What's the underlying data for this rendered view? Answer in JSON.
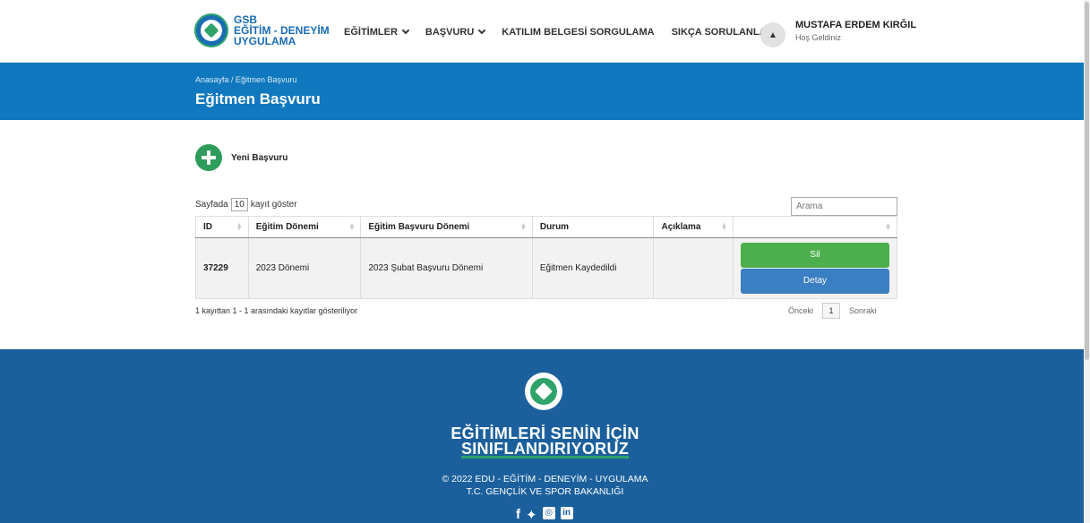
{
  "header": {
    "logo": {
      "line1": "GSB",
      "line2": "EĞİTİM - DENEYİM",
      "line3": "UYGULAMA"
    },
    "nav": [
      {
        "label": "EĞİTİMLER",
        "dropdown": true
      },
      {
        "label": "BAŞVURU",
        "dropdown": true
      },
      {
        "label": "KATILIM BELGESİ SORGULAMA",
        "dropdown": false
      },
      {
        "label": "SIKÇA SORULANLAR",
        "dropdown": false
      }
    ],
    "user": {
      "name": "MUSTAFA ERDEM KIRĞIL",
      "greeting": "Hoş Geldiniz"
    }
  },
  "banner": {
    "breadcrumb": "Anasayfa  /  Eğitmen Başvuru",
    "title": "Eğitmen Başvuru"
  },
  "actions": {
    "new_application": "Yeni Başvuru"
  },
  "table_controls": {
    "length_prefix": "Sayfada",
    "length_value": "10",
    "length_suffix": "kayıt göster",
    "search_placeholder": "Arama"
  },
  "table": {
    "columns": [
      "ID",
      "Eğitim Dönemi",
      "Eğitim Başvuru Dönemi",
      "Durum",
      "Açıklama",
      ""
    ],
    "rows": [
      {
        "id": "37229",
        "period": "2023 Dönemi",
        "application_period": "2023 Şubat Başvuru Dönemi",
        "status": "Eğitmen Kaydedildi",
        "note": "",
        "delete_label": "Sil",
        "detail_label": "Detay"
      }
    ],
    "info": "1 kayıttan 1 - 1 arasındaki kayıtlar gösteriliyor",
    "pager": {
      "prev": "Önceki",
      "current": "1",
      "next": "Sonraki"
    }
  },
  "footer": {
    "slogan_line1": "EĞİTİMLERİ SENİN İÇİN",
    "slogan_line2": "SINIFLANDIRIYORUZ",
    "copyright": "© 2022 EDU - EĞİTİM - DENEYİM - UYGULAMA",
    "ministry": "T.C. GENÇLİK VE SPOR BAKANLIĞI"
  },
  "colors": {
    "primary_blue": "#0f78be",
    "footer_blue": "#1b609c",
    "green": "#2e9c5b",
    "delete_green": "#4cae4c",
    "detail_blue": "#3a7fc1"
  }
}
